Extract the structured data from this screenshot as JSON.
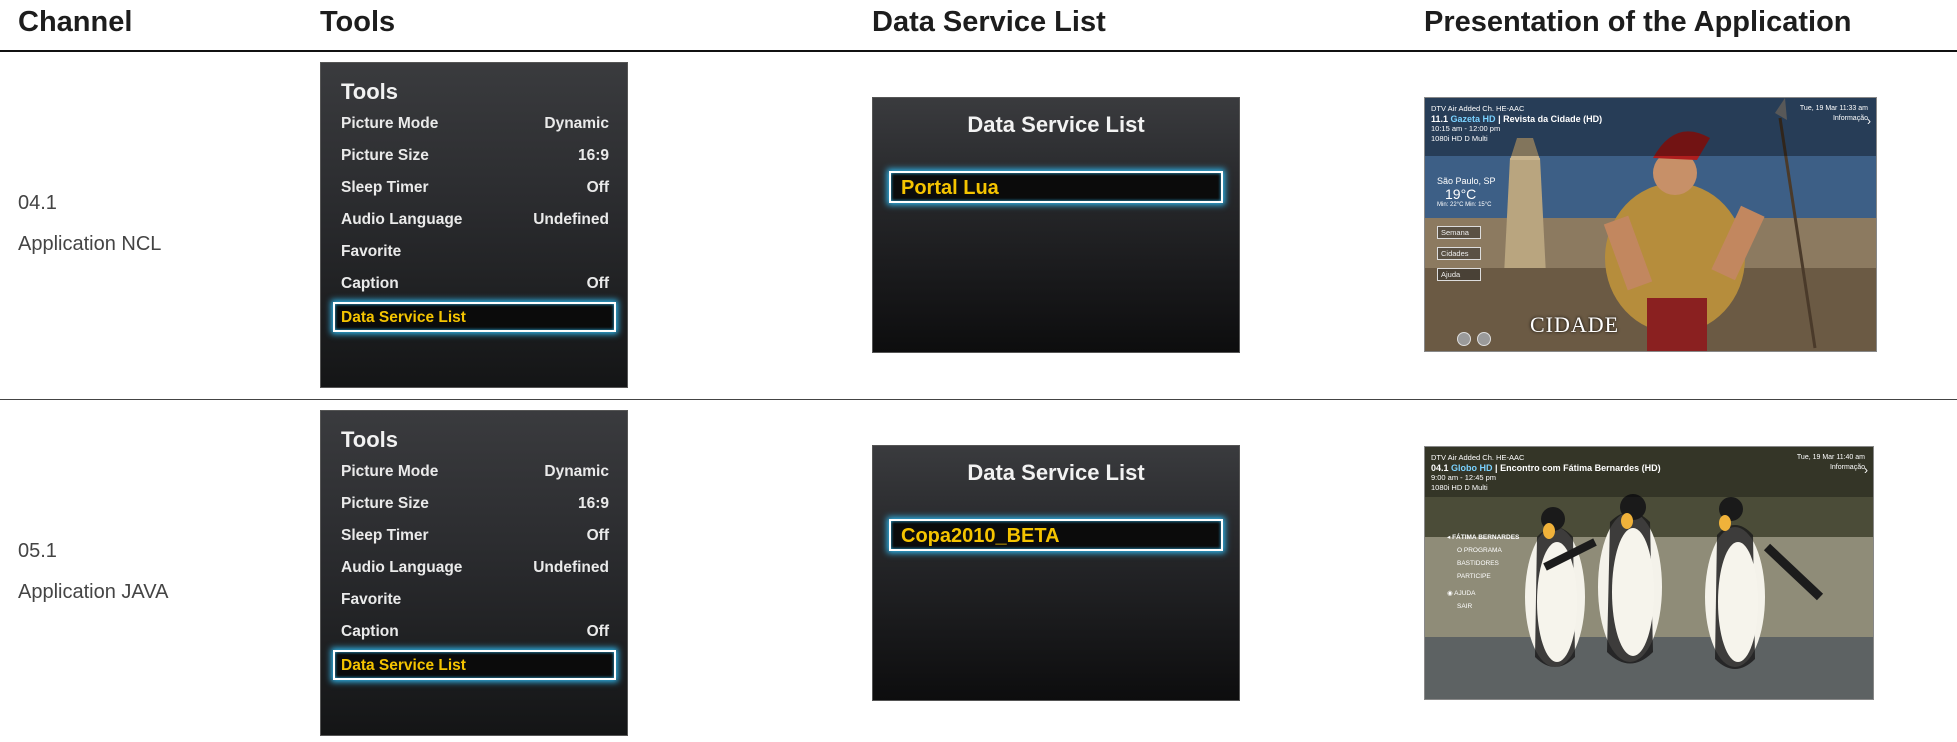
{
  "headers": {
    "channel": "Channel",
    "tools": "Tools",
    "data_service_list": "Data Service List",
    "presentation": "Presentation of the Application"
  },
  "rows": [
    {
      "channel_number": "04.1",
      "channel_app": "Application NCL",
      "tools_menu": {
        "title": "Tools",
        "items": [
          {
            "label": "Picture Mode",
            "value": "Dynamic"
          },
          {
            "label": "Picture Size",
            "value": "16:9"
          },
          {
            "label": "Sleep Timer",
            "value": "Off"
          },
          {
            "label": "Audio Language",
            "value": "Undefined"
          },
          {
            "label": "Favorite",
            "value": ""
          },
          {
            "label": "Caption",
            "value": "Off"
          },
          {
            "label": "Data Service List",
            "value": ""
          }
        ]
      },
      "data_service": {
        "title": "Data Service List",
        "item": "Portal Lua"
      },
      "app_screen": {
        "source": "DTV Air Added Ch. HE-AAC",
        "channel_line_num": "11.1",
        "channel_line_name": "Gazeta HD",
        "program": "Revista da Cidade (HD)",
        "time": "10:15 am - 12:00 pm",
        "format": "1080i  HD  D  Multi",
        "datetime": "Tue, 19 Mar  11:33 am",
        "info": "Informação",
        "city": "São Paulo, SP",
        "temperature": "19°C",
        "minmax": "Min: 22°C  Min: 15°C",
        "buttons": [
          "Semana",
          "Cidades",
          "Ajuda"
        ],
        "brand": "CIDADE"
      }
    },
    {
      "channel_number": "05.1",
      "channel_app": "Application JAVA",
      "tools_menu": {
        "title": "Tools",
        "items": [
          {
            "label": "Picture Mode",
            "value": "Dynamic"
          },
          {
            "label": "Picture Size",
            "value": "16:9"
          },
          {
            "label": "Sleep Timer",
            "value": "Off"
          },
          {
            "label": "Audio Language",
            "value": "Undefined"
          },
          {
            "label": "Favorite",
            "value": ""
          },
          {
            "label": "Caption",
            "value": "Off"
          },
          {
            "label": "Data Service List",
            "value": ""
          }
        ]
      },
      "data_service": {
        "title": "Data Service List",
        "item": "Copa2010_BETA"
      },
      "app_screen": {
        "source": "DTV Air Added Ch. HE-AAC",
        "channel_line_num": "04.1",
        "channel_line_name": "Globo HD",
        "program": "Encontro com Fátima Bernardes (HD)",
        "time": "9:00 am - 12:45 pm",
        "format": "1080i  HD  D  Multi",
        "datetime": "Tue, 19 Mar  11:40 am",
        "info": "Informação",
        "menu": [
          "FÁTIMA BERNARDES",
          "O PROGRAMA",
          "BASTIDORES",
          "PARTICIPE",
          "AJUDA",
          "SAIR"
        ]
      }
    }
  ],
  "colors": {
    "highlight_text": "#f5c400",
    "focus_glow": "#2fb6ec",
    "menu_text": "#eaeaea"
  }
}
